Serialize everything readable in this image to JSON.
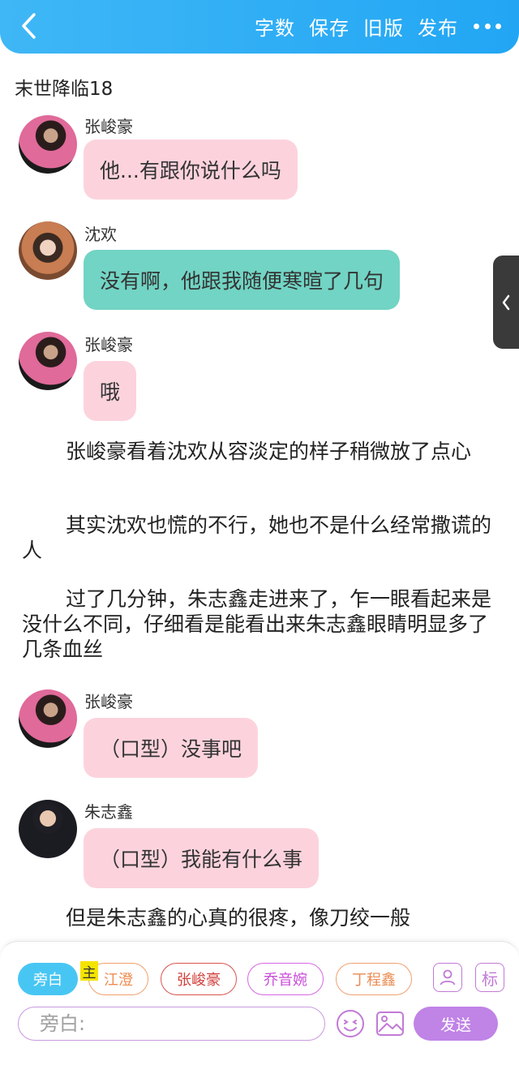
{
  "header": {
    "word_count_label": "字数",
    "save_label": "保存",
    "old_version_label": "旧版",
    "publish_label": "发布"
  },
  "story": {
    "title": "末世降临18"
  },
  "messages": [
    {
      "speaker": "张峻豪",
      "text": "他...有跟你说什么吗",
      "color": "#fcd3dd"
    },
    {
      "speaker": "沈欢",
      "text": "没有啊，他跟我随便寒暄了几句",
      "color": "#72d4c4"
    },
    {
      "speaker": "张峻豪",
      "text": "哦",
      "color": "#fcd3dd"
    },
    {
      "speaker": "张峻豪",
      "text": "（口型）没事吧",
      "color": "#fcd3dd"
    },
    {
      "speaker": "朱志鑫",
      "text": "（口型）我能有什么事",
      "color": "#fcd3dd"
    }
  ],
  "narrations": [
    "张峻豪看着沈欢从容淡定的样子稍微放了点心",
    "其实沈欢也慌的不行，她也不是什么经常撒谎的人",
    "过了几分钟，朱志鑫走进来了，乍一眼看起来是没什么不同，仔细看是能看出来朱志鑫眼睛明显多了几条血丝",
    "但是朱志鑫的心真的很疼，像刀绞一般"
  ],
  "roles": {
    "narrator": "旁白",
    "main_tag": "主",
    "jiangcheng": "江澄",
    "zhangjunhao": "张峻豪",
    "qiaoyinwan": "乔音婉",
    "dingchengxin": "丁程鑫",
    "mark_label": "标"
  },
  "input": {
    "placeholder": "旁白:"
  },
  "send_label": "发送",
  "colors": {
    "header": "#22a6f4",
    "pink_bubble": "#fcd3dd",
    "teal_bubble": "#72d4c4",
    "send_button": "#c083e6"
  }
}
